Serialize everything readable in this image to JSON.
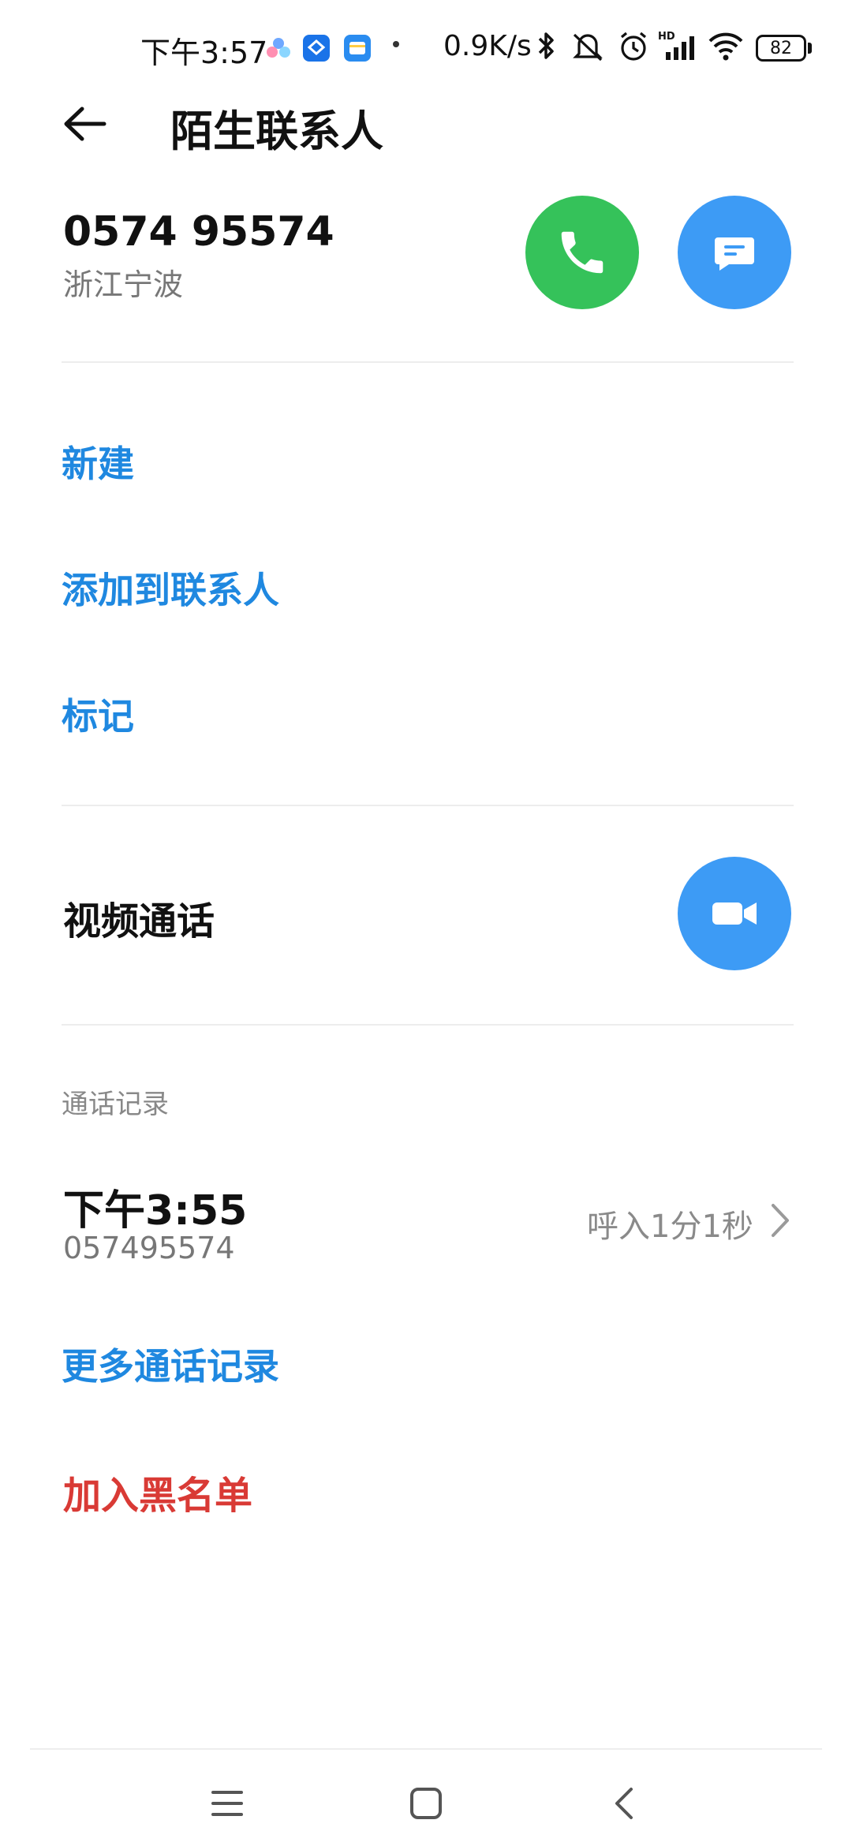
{
  "status_bar": {
    "time": "下午3:57",
    "net_speed": "0.9K/s",
    "battery_level": "82",
    "icons": [
      "cluster-icon",
      "bank-app-icon",
      "wallet-app-icon",
      "bluetooth-icon",
      "mute-icon",
      "alarm-icon",
      "hd-signal-icon",
      "wifi-icon",
      "battery-icon"
    ]
  },
  "header": {
    "title": "陌生联系人"
  },
  "contact": {
    "number": "0574 95574",
    "location": "浙江宁波"
  },
  "actions": {
    "new": "新建",
    "add_to_contacts": "添加到联系人",
    "mark": "标记"
  },
  "video": {
    "label": "视频通话"
  },
  "call_log": {
    "section_label": "通话记录",
    "entries": [
      {
        "time": "下午3:55",
        "number": "057495574",
        "summary": "呼入1分1秒"
      }
    ],
    "more_label": "更多通话记录"
  },
  "blacklist": {
    "label": "加入黑名单"
  },
  "colors": {
    "accent_blue": "#1f88e0",
    "call_green": "#35c25a",
    "button_blue": "#3d9bf5",
    "danger_red": "#d93a35"
  }
}
